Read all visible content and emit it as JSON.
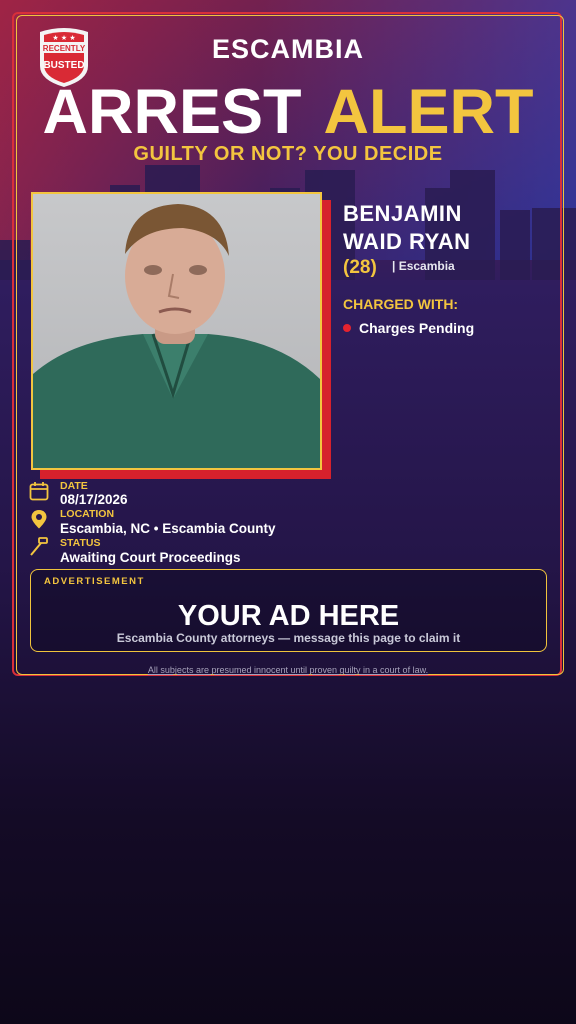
{
  "brand": {
    "badge_line1": "RECENTLY",
    "badge_line2": "BUSTED"
  },
  "header": {
    "county": "ESCAMBIA",
    "headline_word1": "ARREST",
    "headline_word2": "ALERT",
    "tagline": "GUILTY OR NOT? YOU DECIDE"
  },
  "subject": {
    "name_line1": "BENJAMIN",
    "name_line2": "WAID RYAN",
    "age": "(28)",
    "county_tag": "| Escambia",
    "charged_label": "CHARGED WITH:",
    "charges": [
      "Charges Pending"
    ]
  },
  "details": {
    "date_label": "DATE",
    "date_value": "08/17/2026",
    "location_label": "LOCATION",
    "location_value": "Escambia, NC • Escambia County",
    "status_label": "STATUS",
    "status_value": "Awaiting Court Proceedings"
  },
  "ad": {
    "label": "ADVERTISEMENT",
    "title": "YOUR AD HERE",
    "subtitle": "Escambia County attorneys — message this page to claim it"
  },
  "footer": {
    "disclaimer": "All subjects are presumed innocent until proven guilty in a court of law."
  },
  "colors": {
    "accent_gold": "#f3c53f",
    "accent_red": "#d6212c"
  },
  "icons": {
    "date": "calendar-icon",
    "location": "map-pin-icon",
    "status": "gavel-icon"
  }
}
